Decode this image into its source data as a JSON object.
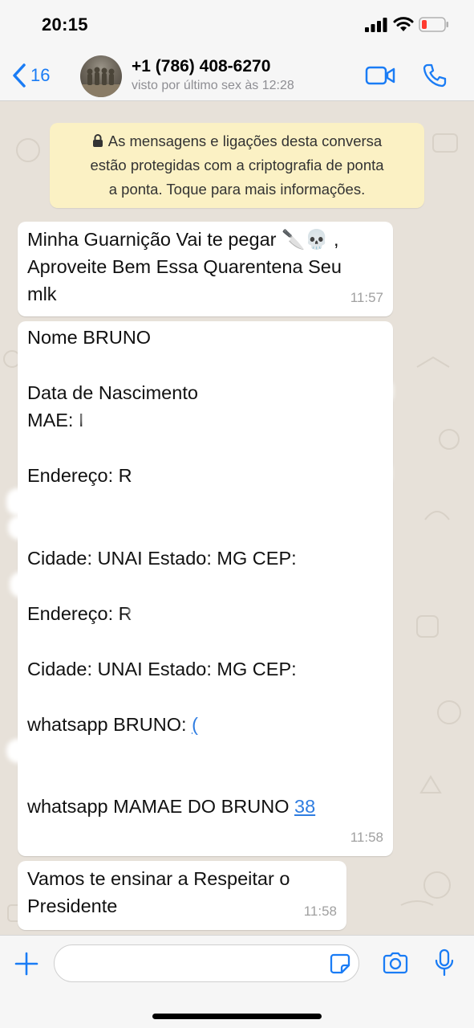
{
  "status_bar": {
    "time": "20:15"
  },
  "header": {
    "back_count": "16",
    "contact_name": "+1 (786) 408-6270",
    "contact_status": "visto por último sex às 12:28"
  },
  "encryption_notice": {
    "lines": [
      "As mensagens e ligações desta conversa",
      "estão protegidas com a criptografia de ponta",
      "a ponta. Toque para mais informações."
    ]
  },
  "messages": [
    {
      "lines": [
        "Minha Guarnição Vai te pegar 🔪💀 ,",
        "Aproveite Bem Essa Quarentena Seu",
        "mlk"
      ],
      "time": "11:57"
    },
    {
      "lines": {
        "nome": "Nome BRUNO",
        "nascimento": "Data de Nascimento",
        "mae": "MAE: I",
        "endereco1": "Endereço: R",
        "cidade1": "Cidade: UNAI Estado: MG CEP:",
        "endereco2": "Endereço: R",
        "cidade2": "Cidade: UNAI Estado: MG CEP:",
        "whatsapp1": "whatsapp BRUNO:",
        "whatsapp1_link": "(",
        "whatsapp2": "whatsapp MAMAE DO BRUNO",
        "whatsapp2_link": "38"
      },
      "time": "11:58"
    },
    {
      "lines": [
        "Vamos te ensinar a Respeitar o",
        "Presidente"
      ],
      "time": "11:58"
    }
  ],
  "input": {
    "placeholder": ""
  },
  "colors": {
    "accent": "#1a7cf5",
    "link": "#2f7de1",
    "notice_bg": "#fbf1c4",
    "chat_bg": "#e7e1d9"
  }
}
